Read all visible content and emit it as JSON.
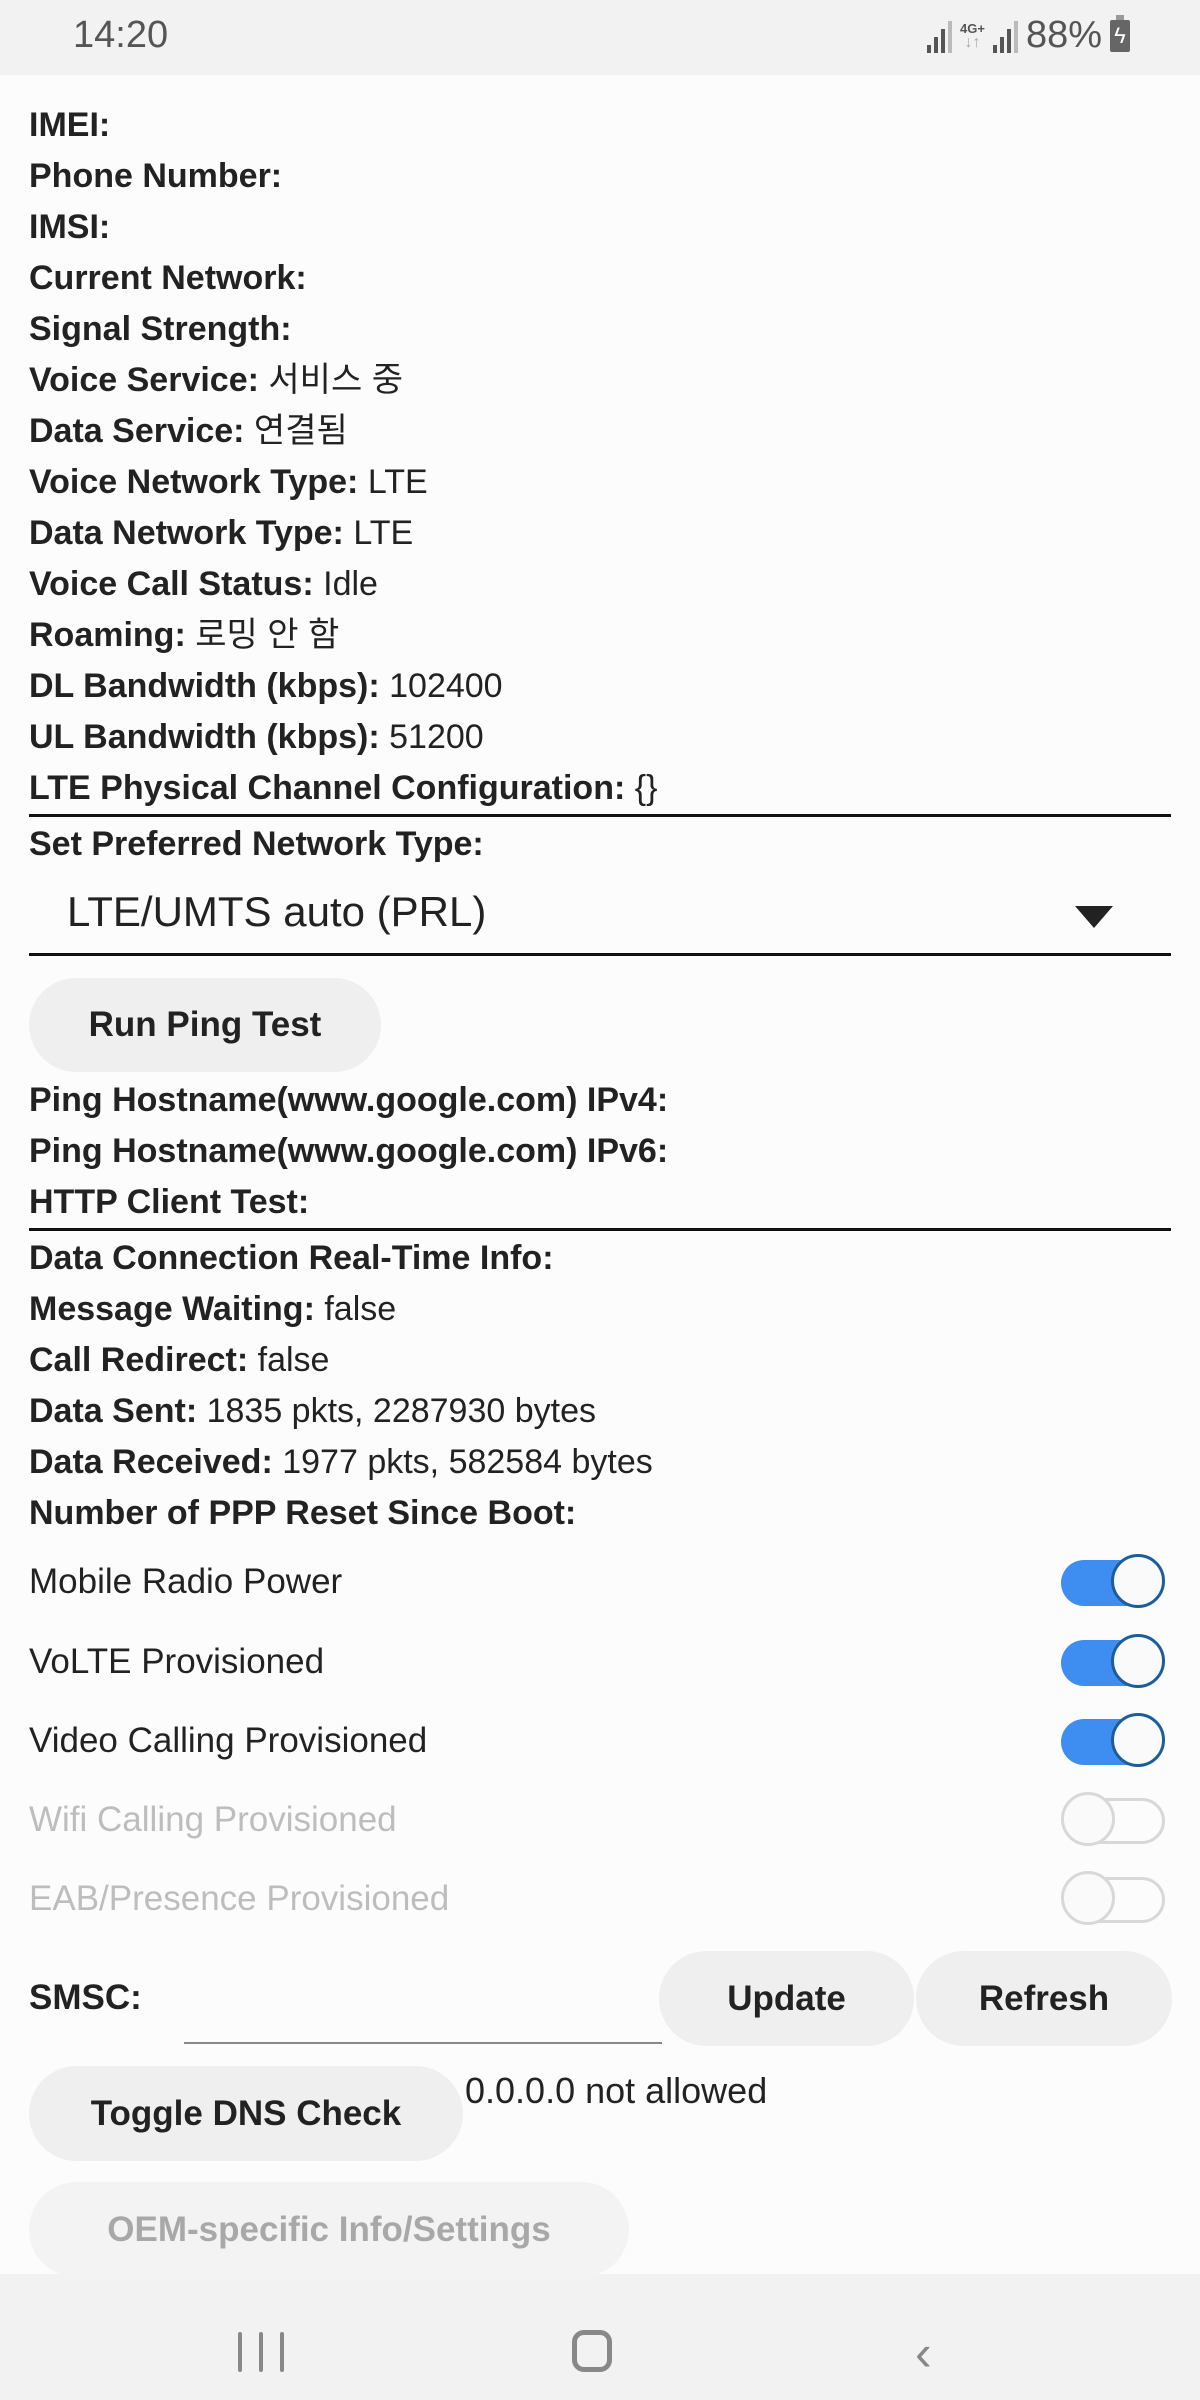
{
  "status_bar": {
    "time": "14:20",
    "network_label": "4G+",
    "battery_percent": "88%",
    "icons": [
      "signal-icon",
      "network-4g-icon",
      "signal-icon",
      "battery-charging-icon"
    ]
  },
  "info": [
    {
      "label": "IMEI:",
      "value": ""
    },
    {
      "label": "Phone Number:",
      "value": ""
    },
    {
      "label": "IMSI:",
      "value": ""
    },
    {
      "label": "Current Network:",
      "value": ""
    },
    {
      "label": "Signal Strength:",
      "value": ""
    },
    {
      "label": "Voice Service:",
      "value": "서비스 중"
    },
    {
      "label": "Data Service:",
      "value": "연결됨"
    },
    {
      "label": "Voice Network Type:",
      "value": "LTE"
    },
    {
      "label": "Data Network Type:",
      "value": "LTE"
    },
    {
      "label": "Voice Call Status:",
      "value": "Idle"
    },
    {
      "label": "Roaming:",
      "value": "로밍 안 함"
    },
    {
      "label": "DL Bandwidth (kbps):",
      "value": "102400"
    },
    {
      "label": "UL Bandwidth (kbps):",
      "value": "51200"
    },
    {
      "label": "LTE Physical Channel Configuration:",
      "value": "{}"
    }
  ],
  "preferred_network": {
    "label": "Set Preferred Network Type:",
    "selected": "LTE/UMTS auto (PRL)"
  },
  "ping": {
    "button": "Run Ping Test",
    "ipv4_label": "Ping Hostname(www.google.com) IPv4:",
    "ipv6_label": "Ping Hostname(www.google.com) IPv6:",
    "http_label": "HTTP Client Test:"
  },
  "data_info": [
    {
      "label": "Data Connection Real-Time Info:",
      "value": ""
    },
    {
      "label": "Message Waiting:",
      "value": "false"
    },
    {
      "label": "Call Redirect:",
      "value": "false"
    },
    {
      "label": "Data Sent:",
      "value": "1835 pkts, 2287930 bytes"
    },
    {
      "label": "Data Received:",
      "value": "1977 pkts, 582584 bytes"
    },
    {
      "label": "Number of PPP Reset Since Boot:",
      "value": ""
    }
  ],
  "toggles": [
    {
      "label": "Mobile Radio Power",
      "on": true,
      "enabled": true
    },
    {
      "label": "VoLTE Provisioned",
      "on": true,
      "enabled": true
    },
    {
      "label": "Video Calling Provisioned",
      "on": true,
      "enabled": true
    },
    {
      "label": "Wifi Calling Provisioned",
      "on": false,
      "enabled": false
    },
    {
      "label": "EAB/Presence Provisioned",
      "on": false,
      "enabled": false
    }
  ],
  "smsc": {
    "label": "SMSC:",
    "value": "",
    "update_button": "Update",
    "refresh_button": "Refresh"
  },
  "dns": {
    "button": "Toggle DNS Check",
    "status": "0.0.0.0 not allowed"
  },
  "oem_button": "OEM-specific Info/Settings",
  "colors": {
    "switch_on": "#3d8ef0",
    "switch_knob_border": "#1d5d99",
    "disabled_text": "#bdbdbd"
  }
}
